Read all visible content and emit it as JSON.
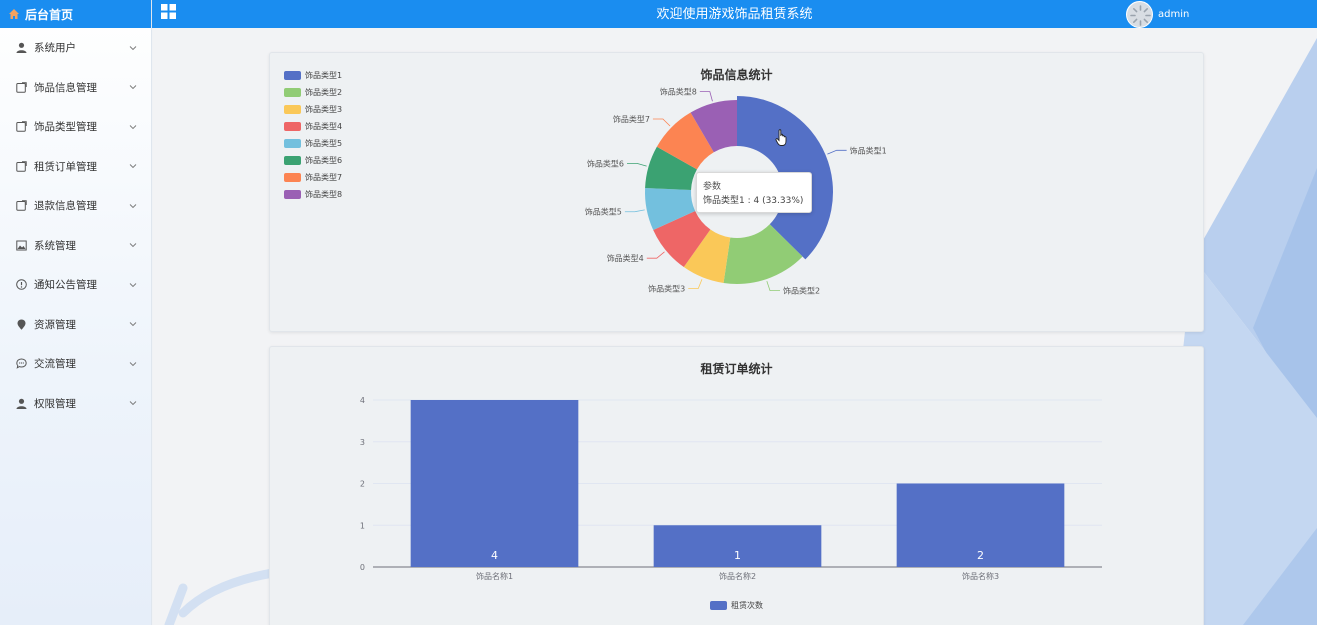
{
  "sidebar": {
    "brand": "后台首页",
    "items": [
      {
        "label": "系统用户",
        "icon": "user-icon"
      },
      {
        "label": "饰品信息管理",
        "icon": "edit-icon"
      },
      {
        "label": "饰品类型管理",
        "icon": "edit-icon"
      },
      {
        "label": "租赁订单管理",
        "icon": "edit-icon"
      },
      {
        "label": "退款信息管理",
        "icon": "edit-icon"
      },
      {
        "label": "系统管理",
        "icon": "picture-icon"
      },
      {
        "label": "通知公告管理",
        "icon": "info-icon"
      },
      {
        "label": "资源管理",
        "icon": "location-icon"
      },
      {
        "label": "交流管理",
        "icon": "chat-icon"
      },
      {
        "label": "权限管理",
        "icon": "user-icon"
      }
    ]
  },
  "header": {
    "title": "欢迎使用游戏饰品租赁系统",
    "username": "admin"
  },
  "colors": {
    "header_bg": "#1a8df0",
    "palette": [
      "#5470c6",
      "#91cc75",
      "#fac858",
      "#ee6666",
      "#73c0de",
      "#3ba272",
      "#fc8452",
      "#9a60b4"
    ]
  },
  "tooltip": {
    "title": "参数",
    "text": "饰品类型1 : 4 (33.33%)"
  },
  "chart_data": [
    {
      "type": "pie",
      "title": "饰品信息统计",
      "series_name": "参数",
      "categories": [
        "饰品类型1",
        "饰品类型2",
        "饰品类型3",
        "饰品类型4",
        "饰品类型5",
        "饰品类型6",
        "饰品类型7",
        "饰品类型8"
      ],
      "values": [
        4,
        1.6,
        0.8,
        0.9,
        0.8,
        0.8,
        0.9,
        0.9
      ],
      "highlighted": "饰品类型1",
      "legend_position": "top-left"
    },
    {
      "type": "bar",
      "title": "租赁订单统计",
      "categories": [
        "饰品名称1",
        "饰品名称2",
        "饰品名称3"
      ],
      "series": [
        {
          "name": "租赁次数",
          "values": [
            4,
            1,
            2
          ]
        }
      ],
      "ylim": [
        0,
        4
      ],
      "yticks": [
        "0",
        "1",
        "2",
        "3",
        "4"
      ],
      "legend_position": "bottom-center",
      "grid": true
    }
  ]
}
